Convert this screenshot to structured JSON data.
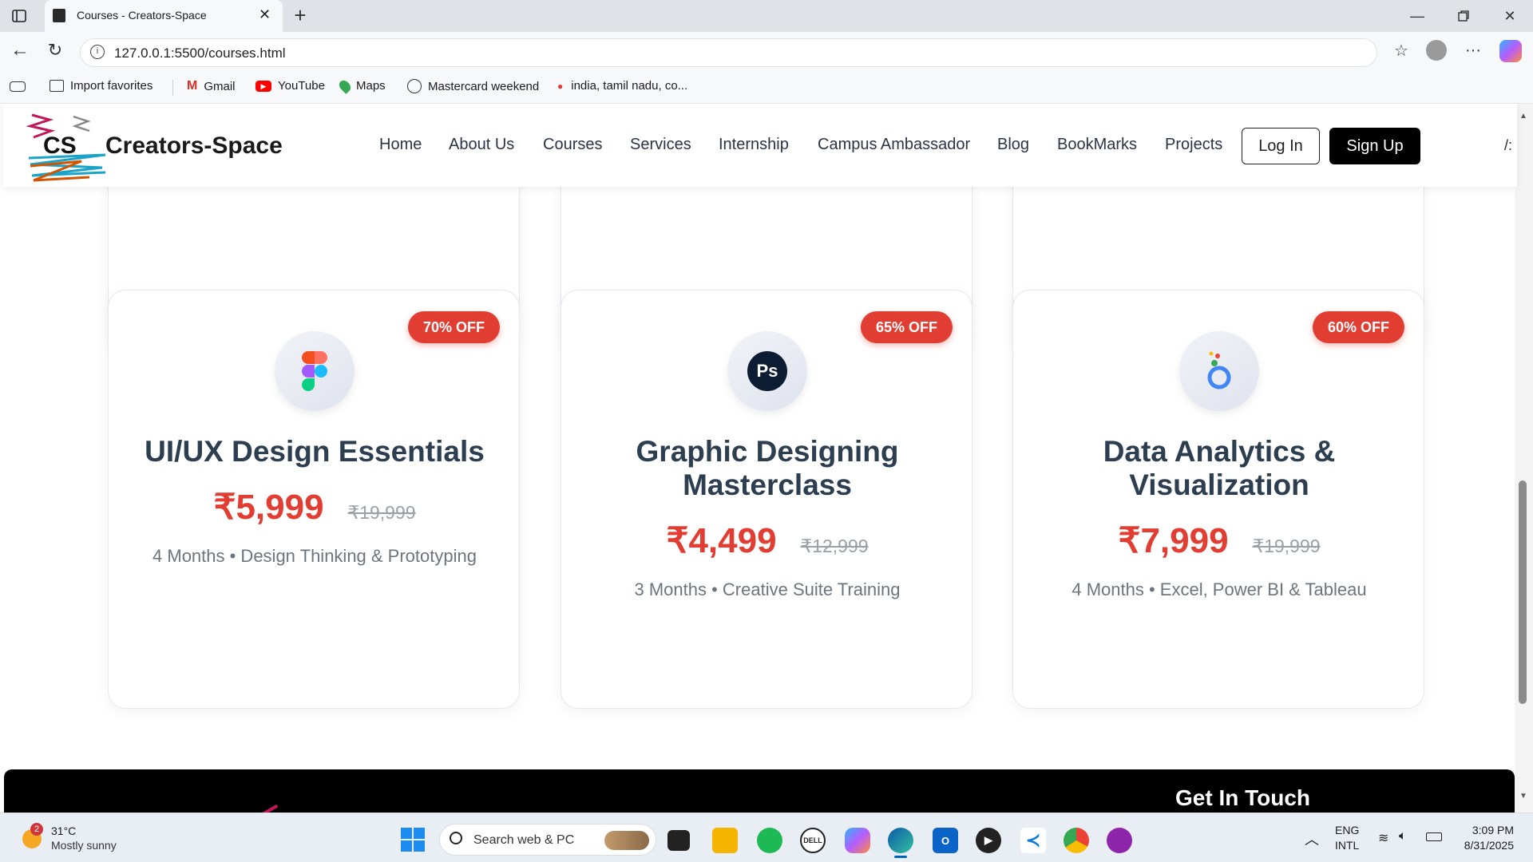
{
  "browser": {
    "tab_title": "Courses - Creators-Space",
    "url": "127.0.0.1:5500/courses.html",
    "favorites": [
      {
        "label": "Import favorites",
        "icon": "import-icon"
      },
      {
        "label": "Gmail",
        "icon": "gmail-icon"
      },
      {
        "label": "YouTube",
        "icon": "youtube-icon"
      },
      {
        "label": "Maps",
        "icon": "maps-pin-icon"
      },
      {
        "label": "Mastercard weekend",
        "icon": "globe-icon"
      },
      {
        "label": "india, tamil nadu, co...",
        "icon": "drop-icon"
      }
    ]
  },
  "site": {
    "logo_mark": "CS",
    "brand": "Creators-Space",
    "nav": [
      "Home",
      "About Us",
      "Courses",
      "Services",
      "Internship",
      "Campus Ambassador",
      "Blog",
      "BookMarks",
      "Projects"
    ],
    "login_label": "Log In",
    "signup_label": "Sign Up",
    "theme_toggle": "/:"
  },
  "courses": [
    {
      "badge": "70% OFF",
      "title": "UI/UX Design Essentials",
      "price": "₹5,999",
      "old_price": "₹19,999",
      "meta": "4 Months • Design Thinking & Prototyping",
      "icon": "figma-icon"
    },
    {
      "badge": "65% OFF",
      "title": "Graphic Designing Masterclass",
      "price": "₹4,499",
      "old_price": "₹12,999",
      "meta": "3 Months • Creative Suite Training",
      "icon": "photoshop-icon",
      "icon_text": "Ps"
    },
    {
      "badge": "60% OFF",
      "title": "Data Analytics & Visualization",
      "price": "₹7,999",
      "old_price": "₹19,999",
      "meta": "4 Months • Excel, Power BI & Tableau",
      "icon": "looker-studio-icon"
    }
  ],
  "footer": {
    "heading": "Get In Touch"
  },
  "taskbar": {
    "weather_temp": "31°C",
    "weather_desc": "Mostly sunny",
    "weather_badge": "2",
    "search_placeholder": "Search web & PC",
    "lang_line1": "ENG",
    "lang_line2": "INTL",
    "time": "3:09 PM",
    "date": "8/31/2025"
  }
}
